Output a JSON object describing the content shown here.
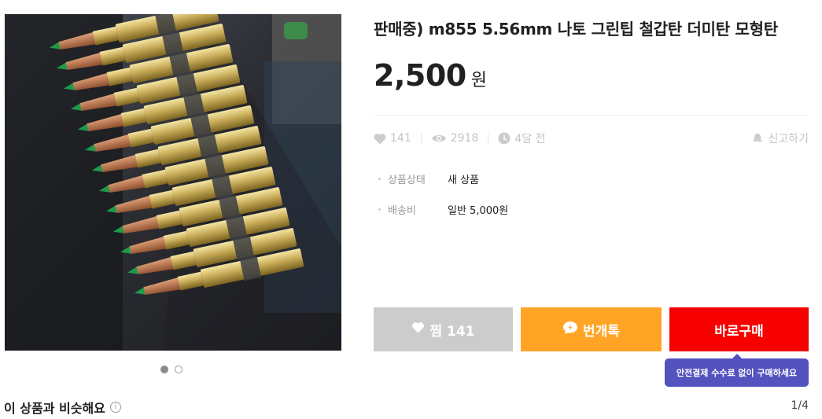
{
  "product": {
    "title": "판매중) m855 5.56mm 나토 그린팁 철갑탄 더미탄 모형탄",
    "price": "2,500",
    "price_unit": "원"
  },
  "stats": {
    "likes": "141",
    "views": "2918",
    "time": "4달 전",
    "report_label": "신고하기"
  },
  "info": [
    {
      "label": "상품상태",
      "value": "새 상품"
    },
    {
      "label": "배송비",
      "value": "일반 5,000원"
    }
  ],
  "buttons": {
    "like_label": "찜 141",
    "chat_label": "번개톡",
    "buy_label": "바로구매"
  },
  "tooltip": "안전결제 수수료 없이 구매하세요",
  "similar": {
    "heading": "이 상품과 비슷해요",
    "info_icon": "i",
    "pager": "1/4"
  },
  "carousel": {
    "count": 2,
    "active": 1
  },
  "colors": {
    "like_button": "#cccccc",
    "chat_button": "#ffa425",
    "buy_button": "#f70000",
    "tooltip": "#5452bf"
  }
}
